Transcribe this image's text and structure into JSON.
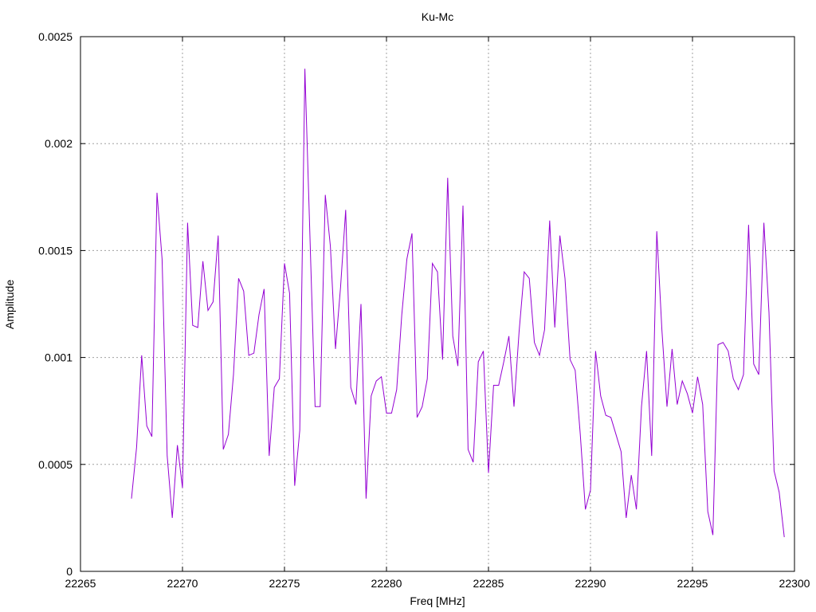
{
  "chart_data": {
    "type": "line",
    "title": "Ku-Mc",
    "xlabel": "Freq [MHz]",
    "ylabel": "Amplitude",
    "xlim": [
      22265,
      22300
    ],
    "ylim": [
      0,
      0.0025
    ],
    "xticks": [
      22265,
      22270,
      22275,
      22280,
      22285,
      22290,
      22295,
      22300
    ],
    "yticks": [
      0,
      0.0005,
      0.001,
      0.0015,
      0.002,
      0.0025
    ],
    "xtick_labels": [
      "22265",
      "22270",
      "22275",
      "22280",
      "22285",
      "22290",
      "22295",
      "22300"
    ],
    "ytick_labels": [
      "0",
      "0.0005",
      "0.001",
      "0.0015",
      "0.002",
      "0.0025"
    ],
    "grid": true,
    "legend": "none",
    "line_color": "#9400d3",
    "series": [
      {
        "x": [
          22267.5,
          22267.75,
          22268.0,
          22268.25,
          22268.5,
          22268.75,
          22269.0,
          22269.25,
          22269.5,
          22269.75,
          22270.0,
          22270.25,
          22270.5,
          22270.75,
          22271.0,
          22271.25,
          22271.5,
          22271.75,
          22272.0,
          22272.25,
          22272.5,
          22272.75,
          22273.0,
          22273.25,
          22273.5,
          22273.75,
          22274.0,
          22274.25,
          22274.5,
          22274.75,
          22275.0,
          22275.25,
          22275.5,
          22275.75,
          22276.0,
          22276.25,
          22276.5,
          22276.75,
          22277.0,
          22277.25,
          22277.5,
          22277.75,
          22278.0,
          22278.25,
          22278.5,
          22278.75,
          22279.0,
          22279.25,
          22279.5,
          22279.75,
          22280.0,
          22280.25,
          22280.5,
          22280.75,
          22281.0,
          22281.25,
          22281.5,
          22281.75,
          22282.0,
          22282.25,
          22282.5,
          22282.75,
          22283.0,
          22283.25,
          22283.5,
          22283.75,
          22284.0,
          22284.25,
          22284.5,
          22284.75,
          22285.0,
          22285.25,
          22285.5,
          22285.75,
          22286.0,
          22286.25,
          22286.5,
          22286.75,
          22287.0,
          22287.25,
          22287.5,
          22287.75,
          22288.0,
          22288.25,
          22288.5,
          22288.75,
          22289.0,
          22289.25,
          22289.5,
          22289.75,
          22290.0,
          22290.25,
          22290.5,
          22290.75,
          22291.0,
          22291.25,
          22291.5,
          22291.75,
          22292.0,
          22292.25,
          22292.5,
          22292.75,
          22293.0,
          22293.25,
          22293.5,
          22293.75,
          22294.0,
          22294.25,
          22294.5,
          22294.75,
          22295.0,
          22295.25,
          22295.5,
          22295.75,
          22296.0,
          22296.25,
          22296.5,
          22296.75,
          22297.0,
          22297.25,
          22297.5,
          22297.75,
          22298.0,
          22298.25,
          22298.5,
          22298.75,
          22299.0,
          22299.25,
          22299.5
        ],
        "y": [
          0.00034,
          0.00058,
          0.00101,
          0.00068,
          0.00063,
          0.00177,
          0.00146,
          0.00054,
          0.00025,
          0.00059,
          0.00039,
          0.00163,
          0.00115,
          0.00114,
          0.00145,
          0.00122,
          0.00126,
          0.00157,
          0.00057,
          0.00064,
          0.00092,
          0.00137,
          0.00131,
          0.00101,
          0.00102,
          0.0012,
          0.00132,
          0.00054,
          0.00086,
          0.0009,
          0.00144,
          0.0013,
          0.0004,
          0.00066,
          0.00235,
          0.00156,
          0.00077,
          0.00077,
          0.00176,
          0.00152,
          0.00104,
          0.00133,
          0.00169,
          0.00086,
          0.00078,
          0.00125,
          0.00034,
          0.00082,
          0.00089,
          0.00091,
          0.00074,
          0.00074,
          0.00085,
          0.0012,
          0.00146,
          0.00158,
          0.00072,
          0.00077,
          0.0009,
          0.00144,
          0.0014,
          0.00099,
          0.00184,
          0.0011,
          0.00096,
          0.00171,
          0.00057,
          0.00051,
          0.00098,
          0.00103,
          0.00046,
          0.00087,
          0.00087,
          0.00098,
          0.0011,
          0.00077,
          0.00112,
          0.0014,
          0.00137,
          0.00107,
          0.00101,
          0.00113,
          0.00164,
          0.00114,
          0.00157,
          0.00137,
          0.00099,
          0.00094,
          0.00064,
          0.00029,
          0.00038,
          0.00103,
          0.00082,
          0.00073,
          0.00072,
          0.00064,
          0.00056,
          0.00025,
          0.00045,
          0.00029,
          0.00077,
          0.00103,
          0.00054,
          0.00159,
          0.00113,
          0.00077,
          0.00104,
          0.00078,
          0.00089,
          0.00083,
          0.00074,
          0.00091,
          0.00078,
          0.00028,
          0.00017,
          0.00106,
          0.00107,
          0.00103,
          0.0009,
          0.00085,
          0.00092,
          0.00162,
          0.00097,
          0.00092,
          0.00163,
          0.00121,
          0.00047,
          0.00037,
          0.00016
        ]
      }
    ]
  }
}
